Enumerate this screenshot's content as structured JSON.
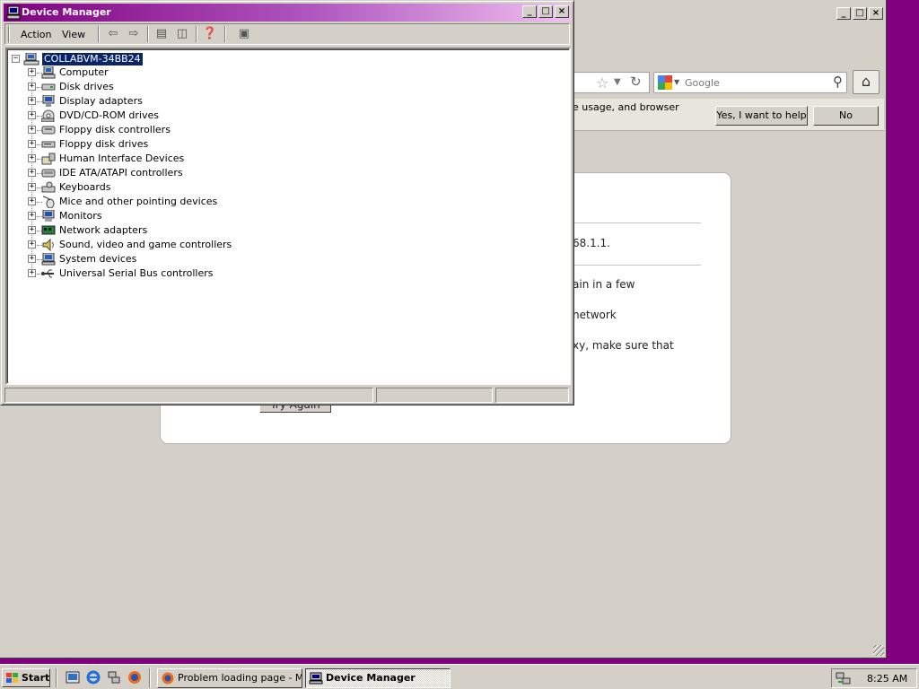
{
  "browser": {
    "search_placeholder": "Google",
    "notification": {
      "message": "e usage, and browser",
      "yes_button": "Yes, I want to help",
      "no_button": "No"
    },
    "error": {
      "line_ip": "68.1.1.",
      "line_retry": "ain in a few",
      "line_network": "network",
      "line_proxy": "xy, make sure that",
      "try_again": "Try Again"
    }
  },
  "device_manager": {
    "title": "Device Manager",
    "menu": {
      "action": "Action",
      "view": "View"
    },
    "root": "COLLABVM-34BB24",
    "categories": [
      {
        "label": "Computer",
        "icon": "computer-icon"
      },
      {
        "label": "Disk drives",
        "icon": "disk-drive-icon"
      },
      {
        "label": "Display adapters",
        "icon": "display-adapter-icon"
      },
      {
        "label": "DVD/CD-ROM drives",
        "icon": "cdrom-icon"
      },
      {
        "label": "Floppy disk controllers",
        "icon": "controller-icon"
      },
      {
        "label": "Floppy disk drives",
        "icon": "floppy-drive-icon"
      },
      {
        "label": "Human Interface Devices",
        "icon": "hid-icon"
      },
      {
        "label": "IDE ATA/ATAPI controllers",
        "icon": "ide-controller-icon"
      },
      {
        "label": "Keyboards",
        "icon": "keyboard-icon"
      },
      {
        "label": "Mice and other pointing devices",
        "icon": "mouse-icon"
      },
      {
        "label": "Monitors",
        "icon": "monitor-icon"
      },
      {
        "label": "Network adapters",
        "icon": "network-adapter-icon"
      },
      {
        "label": "Sound, video and game controllers",
        "icon": "sound-icon"
      },
      {
        "label": "System devices",
        "icon": "system-devices-icon"
      },
      {
        "label": "Universal Serial Bus controllers",
        "icon": "usb-icon"
      }
    ]
  },
  "taskbar": {
    "start_label": "Start",
    "tasks": [
      {
        "label": "Problem loading page - M...",
        "active": false
      },
      {
        "label": "Device Manager",
        "active": true
      }
    ],
    "clock": "8:25 AM"
  },
  "colors": {
    "desktop": "#800080",
    "window_face": "#d4d0c8",
    "selection": "#0a246a"
  }
}
